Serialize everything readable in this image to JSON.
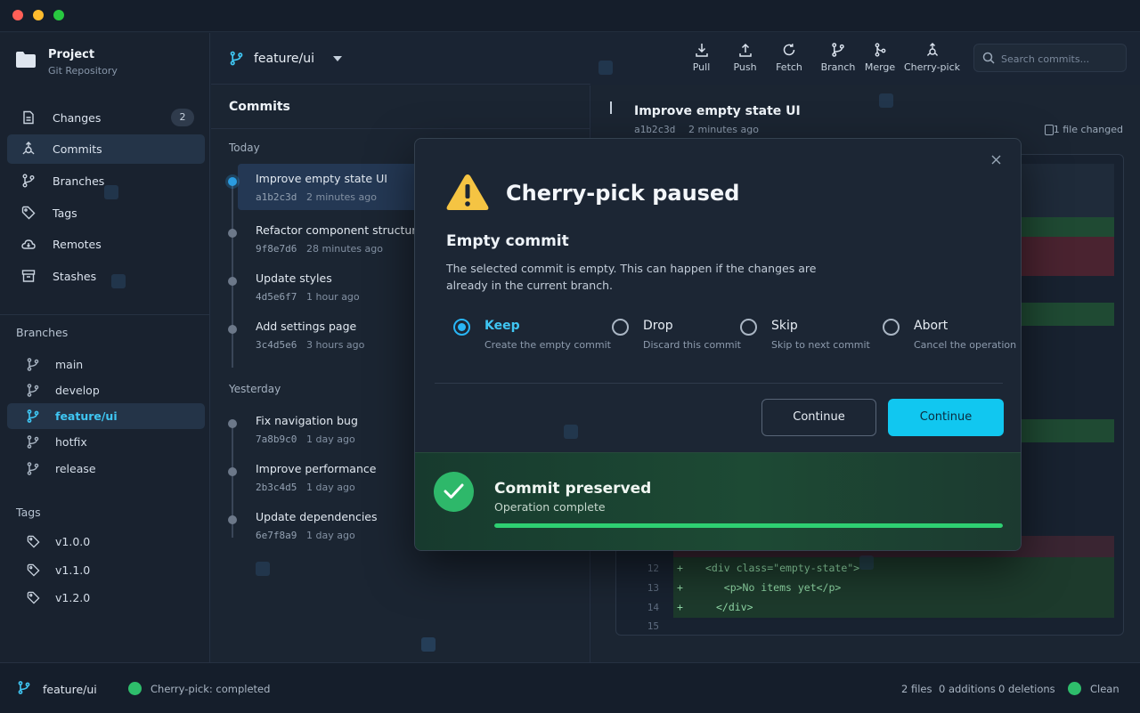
{
  "project": {
    "name": "Project",
    "subtitle": "Git Repository"
  },
  "nav": [
    {
      "label": "Changes",
      "icon": "changes-icon",
      "count": "2"
    },
    {
      "label": "Commits",
      "icon": "commits-icon",
      "active": true
    },
    {
      "label": "Branches",
      "icon": "branches-icon"
    },
    {
      "label": "Tags",
      "icon": "tag-icon"
    },
    {
      "label": "Remotes",
      "icon": "cloud-icon"
    },
    {
      "label": "Stashes",
      "icon": "archive-icon"
    }
  ],
  "branches": {
    "title": "Branches",
    "items": [
      {
        "label": "main"
      },
      {
        "label": "develop"
      },
      {
        "label": "feature/ui",
        "active": true
      },
      {
        "label": "hotfix"
      },
      {
        "label": "release"
      }
    ]
  },
  "tags": {
    "title": "Tags",
    "items": [
      {
        "label": "v1.0.0"
      },
      {
        "label": "v1.1.0"
      },
      {
        "label": "v1.2.0"
      }
    ]
  },
  "current_branch": "feature/ui",
  "toolbar": [
    {
      "label": "Pull",
      "icon": "pull-icon"
    },
    {
      "label": "Push",
      "icon": "push-icon"
    },
    {
      "label": "Fetch",
      "icon": "fetch-icon"
    },
    {
      "label": "Branch",
      "icon": "branch-icon"
    },
    {
      "label": "Merge",
      "icon": "merge-icon"
    },
    {
      "label": "Cherry-pick",
      "icon": "cherry-pick-icon"
    }
  ],
  "search": {
    "placeholder": "Search commits..."
  },
  "commits": {
    "title": "Commits",
    "groups": [
      {
        "label": "Today",
        "items": [
          {
            "message": "Improve empty state UI",
            "hash": "a1b2c3d",
            "time": "2 minutes ago",
            "active": true
          },
          {
            "message": "Refactor component structure",
            "hash": "9f8e7d6",
            "time": "28 minutes ago"
          },
          {
            "message": "Update styles",
            "hash": "4d5e6f7",
            "time": "1 hour ago"
          },
          {
            "message": "Add settings page",
            "hash": "3c4d5e6",
            "time": "3 hours ago"
          }
        ]
      },
      {
        "label": "Yesterday",
        "items": [
          {
            "message": "Fix navigation bug",
            "hash": "7a8b9c0",
            "time": "1 day ago"
          },
          {
            "message": "Improve performance",
            "hash": "2b3c4d5",
            "time": "1 day ago"
          },
          {
            "message": "Update dependencies",
            "hash": "6e7f8a9",
            "time": "1 day ago"
          }
        ]
      }
    ]
  },
  "detail": {
    "title": "Improve empty state UI",
    "hash": "a1b2c3d",
    "time": "2 minutes ago",
    "files_changed": "1 file changed",
    "diff_lines": [
      {
        "num": "12",
        "sign": "+",
        "code": "<div class=\"empty-state\">"
      },
      {
        "num": "13",
        "sign": "+",
        "code": "   <p>No items yet</p>"
      },
      {
        "num": "14",
        "sign": "+",
        "code": "</div>"
      },
      {
        "num": "15",
        "sign": "",
        "code": ""
      }
    ]
  },
  "modal": {
    "title": "Cherry-pick paused",
    "subtitle": "Empty commit",
    "description": "The selected commit is empty. This can happen if the changes are already in the current branch.",
    "options": [
      {
        "label": "Keep",
        "desc": "Create the empty commit",
        "checked": true
      },
      {
        "label": "Drop",
        "desc": "Discard this commit"
      },
      {
        "label": "Skip",
        "desc": "Skip to next commit"
      },
      {
        "label": "Abort",
        "desc": "Cancel the operation"
      }
    ],
    "secondary_button": "Continue",
    "primary_button": "Continue",
    "success": {
      "title": "Commit preserved",
      "subtitle": "Operation complete",
      "progress": 1.0
    }
  },
  "status": {
    "branch": "feature/ui",
    "operation": "Cherry-pick: completed",
    "files": "2 files",
    "additions": "0 additions",
    "deletions": "0 deletions",
    "state": "Clean"
  },
  "colors": {
    "accent": "#11c7f0",
    "success": "#2eb86a",
    "warning": "#f5c443"
  }
}
